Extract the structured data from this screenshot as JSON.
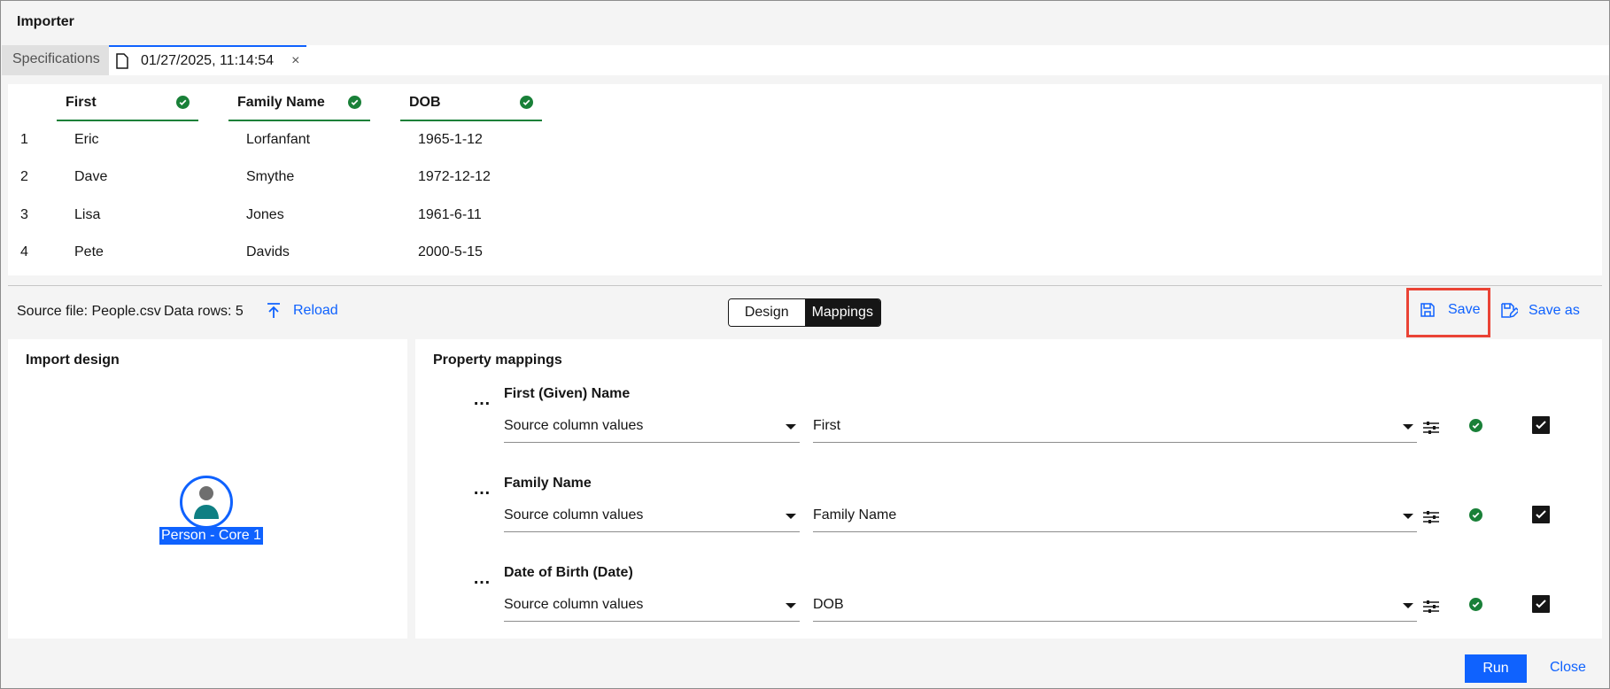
{
  "window": {
    "title": "Importer"
  },
  "tabs": [
    {
      "label": "Specifications"
    },
    {
      "label": "01/27/2025, 11:14:54",
      "close": "×"
    }
  ],
  "preview": {
    "columns": [
      {
        "label": "First"
      },
      {
        "label": "Family Name"
      },
      {
        "label": "DOB"
      }
    ],
    "rows": [
      {
        "number": "1",
        "first": "Eric",
        "family": "Lorfanfant",
        "dob": "1965-1-12"
      },
      {
        "number": "2",
        "first": "Dave",
        "family": "Smythe",
        "dob": "1972-12-12"
      },
      {
        "number": "3",
        "first": "Lisa",
        "family": "Jones",
        "dob": "1961-6-11"
      },
      {
        "number": "4",
        "first": "Pete",
        "family": "Davids",
        "dob": "2000-5-15"
      }
    ]
  },
  "toolbar": {
    "source_file": "Source file: People.csv",
    "data_rows": "Data rows: 5",
    "reload_label": "Reload",
    "design_label": "Design",
    "mappings_label": "Mappings",
    "save_label": "Save",
    "save_as_label": "Save as"
  },
  "design": {
    "title": "Import design",
    "node_label": "Person - Core 1"
  },
  "mappings": {
    "title": "Property mappings",
    "items": [
      {
        "name": "First (Given) Name",
        "source": "Source column values",
        "target": "First"
      },
      {
        "name": "Family Name",
        "source": "Source column values",
        "target": "Family Name"
      },
      {
        "name": "Date of Birth (Date)",
        "source": "Source column values",
        "target": "DOB"
      }
    ]
  },
  "footer": {
    "run_label": "Run",
    "close_label": "Close"
  },
  "colors": {
    "accent": "#0f62fe",
    "success": "#198038",
    "highlight_border": "#ea4335"
  },
  "icons": {
    "tab_file": "document-icon",
    "column_status": "check-circle-icon",
    "reload": "upload-icon",
    "save": "save-icon",
    "save_as": "save-as-icon",
    "mapping_options": "sliders-icon",
    "mapping_status": "check-circle-icon",
    "mapping_checkbox": "checkbox-checked-icon"
  }
}
